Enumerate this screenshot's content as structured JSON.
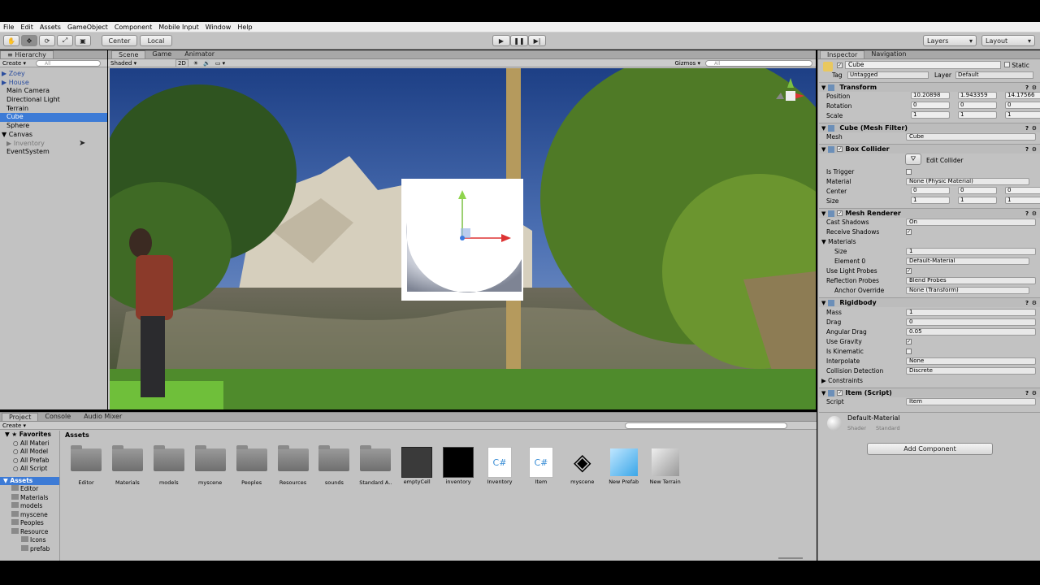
{
  "menubar": [
    "File",
    "Edit",
    "Assets",
    "GameObject",
    "Component",
    "Mobile Input",
    "Window",
    "Help"
  ],
  "toolbar": {
    "center": "Center",
    "local": "Local",
    "layers": "Layers",
    "layout": "Layout"
  },
  "hierarchy": {
    "tab": "Hierarchy",
    "create": "Create",
    "search_placeholder": "All",
    "items": [
      {
        "label": "Zoey",
        "prefix": "▶ "
      },
      {
        "label": "House",
        "prefix": "▶ "
      },
      {
        "label": "Main Camera",
        "prefix": ""
      },
      {
        "label": "Directional Light",
        "prefix": ""
      },
      {
        "label": "Terrain",
        "prefix": ""
      },
      {
        "label": "Cube",
        "prefix": ""
      },
      {
        "label": "Sphere",
        "prefix": ""
      },
      {
        "label": "Canvas",
        "prefix": "▼ "
      },
      {
        "label": "Inventory",
        "prefix": "▶ "
      },
      {
        "label": "EventSystem",
        "prefix": ""
      }
    ]
  },
  "scene": {
    "tabs": [
      "Scene",
      "Game",
      "Animator"
    ],
    "shaded": "Shaded",
    "mode2d": "2D",
    "gizmos": "Gizmos",
    "search_placeholder": "All"
  },
  "inspector": {
    "tabs": [
      "Inspector",
      "Navigation"
    ],
    "object_name": "Cube",
    "static_label": "Static",
    "tag_label": "Tag",
    "tag_value": "Untagged",
    "layer_label": "Layer",
    "layer_value": "Default",
    "transform": {
      "title": "Transform",
      "position_label": "Position",
      "position": [
        "10.20898",
        "1.943359",
        "14.17566"
      ],
      "rotation_label": "Rotation",
      "rotation": [
        "0",
        "0",
        "0"
      ],
      "scale_label": "Scale",
      "scale": [
        "1",
        "1",
        "1"
      ]
    },
    "mesh_filter": {
      "title": "Cube (Mesh Filter)",
      "mesh_label": "Mesh",
      "mesh_value": "Cube"
    },
    "box_collider": {
      "title": "Box Collider",
      "edit_collider": "Edit Collider",
      "is_trigger": "Is Trigger",
      "material_label": "Material",
      "material_value": "None (Physic Material)",
      "center_label": "Center",
      "center": [
        "0",
        "0",
        "0"
      ],
      "size_label": "Size",
      "size": [
        "1",
        "1",
        "1"
      ]
    },
    "mesh_renderer": {
      "title": "Mesh Renderer",
      "cast_shadows": "Cast Shadows",
      "cast_shadows_value": "On",
      "receive_shadows": "Receive Shadows",
      "materials": "Materials",
      "size": "Size",
      "size_value": "1",
      "element0": "Element 0",
      "element0_value": "Default-Material",
      "use_light_probes": "Use Light Probes",
      "reflection_probes": "Reflection Probes",
      "reflection_probes_value": "Blend Probes",
      "anchor_override": "Anchor Override",
      "anchor_override_value": "None (Transform)"
    },
    "rigidbody": {
      "title": "Rigidbody",
      "mass": "Mass",
      "mass_value": "1",
      "drag": "Drag",
      "drag_value": "0",
      "angular_drag": "Angular Drag",
      "angular_drag_value": "0.05",
      "use_gravity": "Use Gravity",
      "is_kinematic": "Is Kinematic",
      "interpolate": "Interpolate",
      "interpolate_value": "None",
      "collision_detection": "Collision Detection",
      "collision_detection_value": "Discrete",
      "constraints": "Constraints"
    },
    "item_script": {
      "title": "Item (Script)",
      "script_label": "Script",
      "script_value": "Item"
    },
    "material": {
      "name": "Default-Material",
      "shader_label": "Shader",
      "shader_value": "Standard"
    },
    "add_component": "Add Component"
  },
  "project": {
    "tabs": [
      "Project",
      "Console",
      "Audio Mixer"
    ],
    "create": "Create",
    "favorites": "Favorites",
    "favorites_items": [
      "All Materi",
      "All Model",
      "All Prefab",
      "All Script"
    ],
    "assets_root": "Assets",
    "tree": [
      "Editor",
      "Materials",
      "models",
      "myscene",
      "Peoples",
      "Resource",
      "Icons",
      "prefab"
    ],
    "breadcrumb": "Assets",
    "assets": [
      {
        "name": "Editor",
        "kind": "folder"
      },
      {
        "name": "Materials",
        "kind": "folder"
      },
      {
        "name": "models",
        "kind": "folder"
      },
      {
        "name": "myscene",
        "kind": "folder"
      },
      {
        "name": "Peoples",
        "kind": "folder"
      },
      {
        "name": "Resources",
        "kind": "folder"
      },
      {
        "name": "sounds",
        "kind": "folder"
      },
      {
        "name": "Standard A..",
        "kind": "folder"
      },
      {
        "name": "emptyCell",
        "kind": "prefab-dark"
      },
      {
        "name": "inventory",
        "kind": "prefab-black"
      },
      {
        "name": "Inventory",
        "kind": "script"
      },
      {
        "name": "Item",
        "kind": "script"
      },
      {
        "name": "myscene",
        "kind": "unity"
      },
      {
        "name": "New Prefab",
        "kind": "cube"
      },
      {
        "name": "New Terrain",
        "kind": "terrain"
      }
    ]
  }
}
